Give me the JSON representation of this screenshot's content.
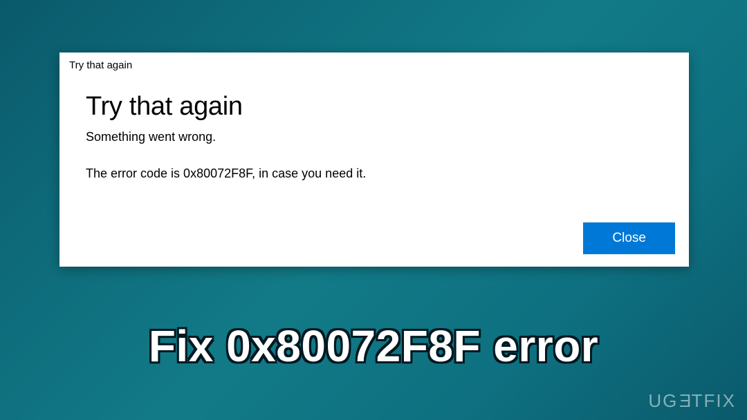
{
  "dialog": {
    "titlebar": "Try that again",
    "heading": "Try that again",
    "subtext": "Something went wrong.",
    "errortext": "The error code is 0x80072F8F, in case you need it.",
    "close_label": "Close"
  },
  "caption": "Fix 0x80072F8F error",
  "watermark": "UGETFIX",
  "colors": {
    "button_bg": "#0078d7",
    "dialog_bg": "#ffffff",
    "page_bg_start": "#0a5a6b",
    "page_bg_end": "#0a5a6b"
  }
}
